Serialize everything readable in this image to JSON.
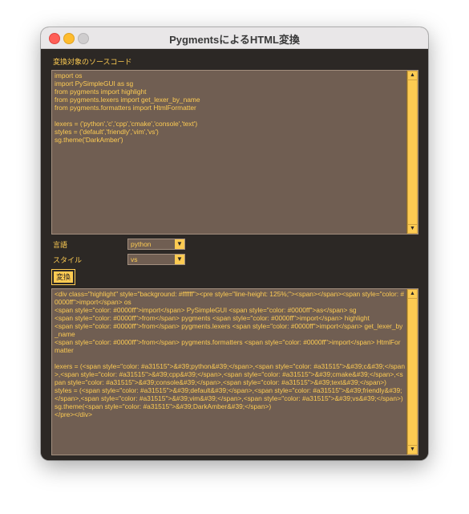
{
  "window": {
    "title": "PygmentsによるHTML変換"
  },
  "form": {
    "source_label": "変換対象のソースコード",
    "source_code": "import os\nimport PySimpleGUI as sg\nfrom pygments import highlight\nfrom pygments.lexers import get_lexer_by_name\nfrom pygments.formatters import HtmlFormatter\n\nlexers = ('python','c','cpp','cmake','console','text')\nstyles = ('default','friendly','vim','vs')\nsg.theme('DarkAmber')",
    "language_label": "言語",
    "language_value": "python",
    "style_label": "スタイル",
    "style_value": "vs",
    "convert_button": "変換",
    "output_html": "<div class=\"highlight\" style=\"background: #ffffff\"><pre style=\"line-height: 125%;\"><span></span><span style=\"color: #0000ff\">import</span> os\n<span style=\"color: #0000ff\">import</span> PySimpleGUI <span style=\"color: #0000ff\">as</span> sg\n<span style=\"color: #0000ff\">from</span> pygments <span style=\"color: #0000ff\">import</span> highlight\n<span style=\"color: #0000ff\">from</span> pygments.lexers <span style=\"color: #0000ff\">import</span> get_lexer_by_name\n<span style=\"color: #0000ff\">from</span> pygments.formatters <span style=\"color: #0000ff\">import</span> HtmlFormatter\n\nlexers = (<span style=\"color: #a31515\">&#39;python&#39;</span>,<span style=\"color: #a31515\">&#39;c&#39;</span>,<span style=\"color: #a31515\">&#39;cpp&#39;</span>,<span style=\"color: #a31515\">&#39;cmake&#39;</span>,<span style=\"color: #a31515\">&#39;console&#39;</span>,<span style=\"color: #a31515\">&#39;text&#39;</span>)\nstyles = (<span style=\"color: #a31515\">&#39;default&#39;</span>,<span style=\"color: #a31515\">&#39;friendly&#39;</span>,<span style=\"color: #a31515\">&#39;vim&#39;</span>,<span style=\"color: #a31515\">&#39;vs&#39;</span>)\nsg.theme(<span style=\"color: #a31515\">&#39;DarkAmber&#39;</span>)\n</pre></div>"
  },
  "colors": {
    "background": "#2c2825",
    "accent": "#fdcb52",
    "input_bg": "#705e52"
  }
}
